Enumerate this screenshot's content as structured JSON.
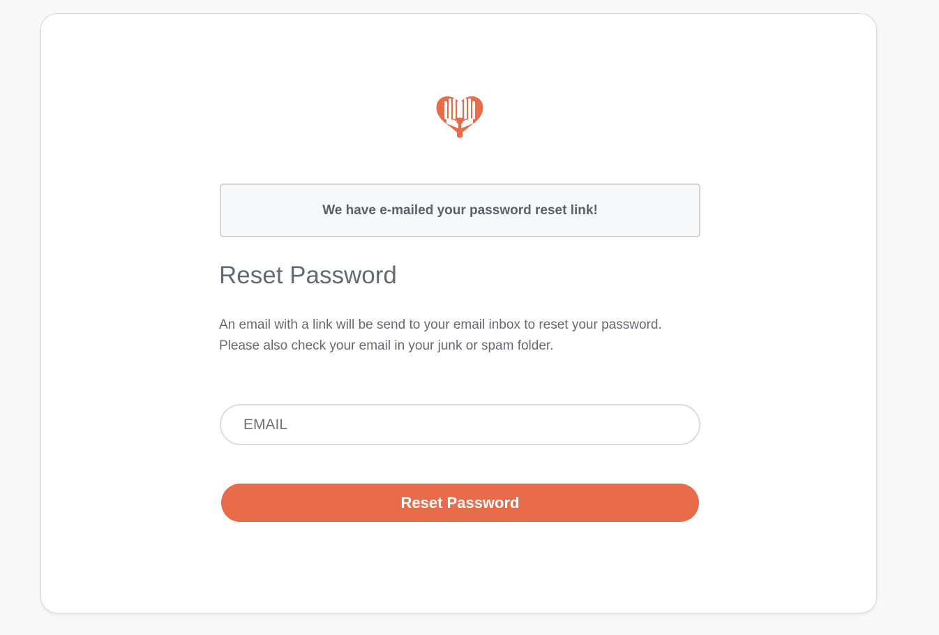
{
  "brand": {
    "logo_icon": "heart-hands-icon",
    "accent_color": "#e86b4a"
  },
  "alert": {
    "message": "We have e-mailed your password reset link!"
  },
  "form": {
    "title": "Reset Password",
    "description_line1": "An email with a link will be send to your email inbox to reset your password.",
    "description_line2": "Please also check your email in your junk or spam folder.",
    "email_placeholder": "EMAIL",
    "email_value": "",
    "submit_label": "Reset Password"
  }
}
